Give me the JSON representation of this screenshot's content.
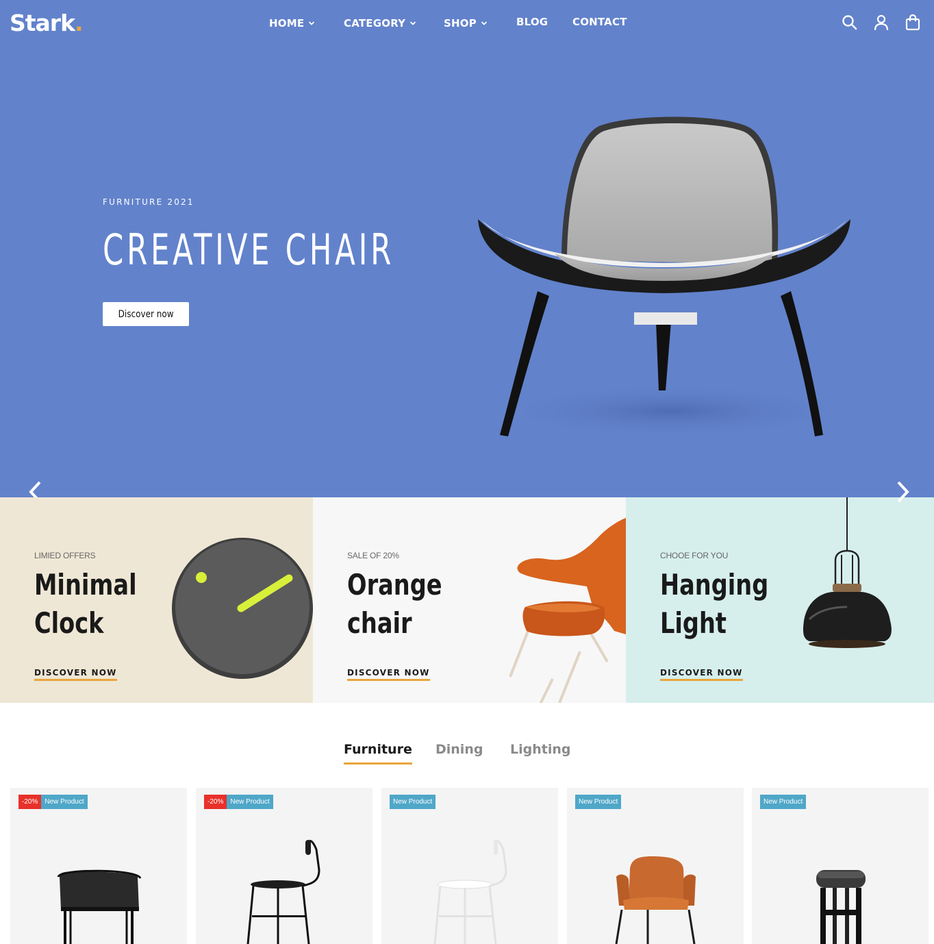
{
  "brand": {
    "name": "Stark",
    "dot": "."
  },
  "nav": {
    "items": [
      {
        "label": "HOME",
        "dropdown": true
      },
      {
        "label": "CATEGORY",
        "dropdown": true
      },
      {
        "label": "SHOP",
        "dropdown": true
      },
      {
        "label": "BLOG",
        "dropdown": false
      },
      {
        "label": "CONTACT",
        "dropdown": false
      }
    ],
    "icons": [
      "search-icon",
      "user-icon",
      "bag-icon"
    ]
  },
  "hero": {
    "subtitle": "FURNITURE 2021",
    "title": "CREATIVE CHAIR",
    "button": "Discover now",
    "background": "#6282cb"
  },
  "banners": [
    {
      "tag": "LIMIED OFFERS",
      "title_line1": "Minimal",
      "title_line2": "Clock",
      "link": "DISCOVER NOW",
      "background": "#efe7d5"
    },
    {
      "tag": "SALE OF 20%",
      "title_line1": "Orange",
      "title_line2": "chair",
      "link": "DISCOVER NOW",
      "background": "#f7f7f7"
    },
    {
      "tag": "CHOOE FOR YOU",
      "title_line1": "Hanging",
      "title_line2": "Light",
      "link": "DISCOVER NOW",
      "background": "#d6efec"
    }
  ],
  "tabs": {
    "items": [
      "Furniture",
      "Dining",
      "Lighting"
    ],
    "active": "Furniture"
  },
  "products": [
    {
      "sale": "-20%",
      "badge": "New Product"
    },
    {
      "sale": "-20%",
      "badge": "New Product"
    },
    {
      "sale": "",
      "badge": "New Product"
    },
    {
      "sale": "",
      "badge": "New Product"
    },
    {
      "sale": "",
      "badge": "New Product"
    }
  ],
  "colors": {
    "accent": "#e8a53c",
    "sale": "#e8312a",
    "new": "#4fa7c8"
  }
}
